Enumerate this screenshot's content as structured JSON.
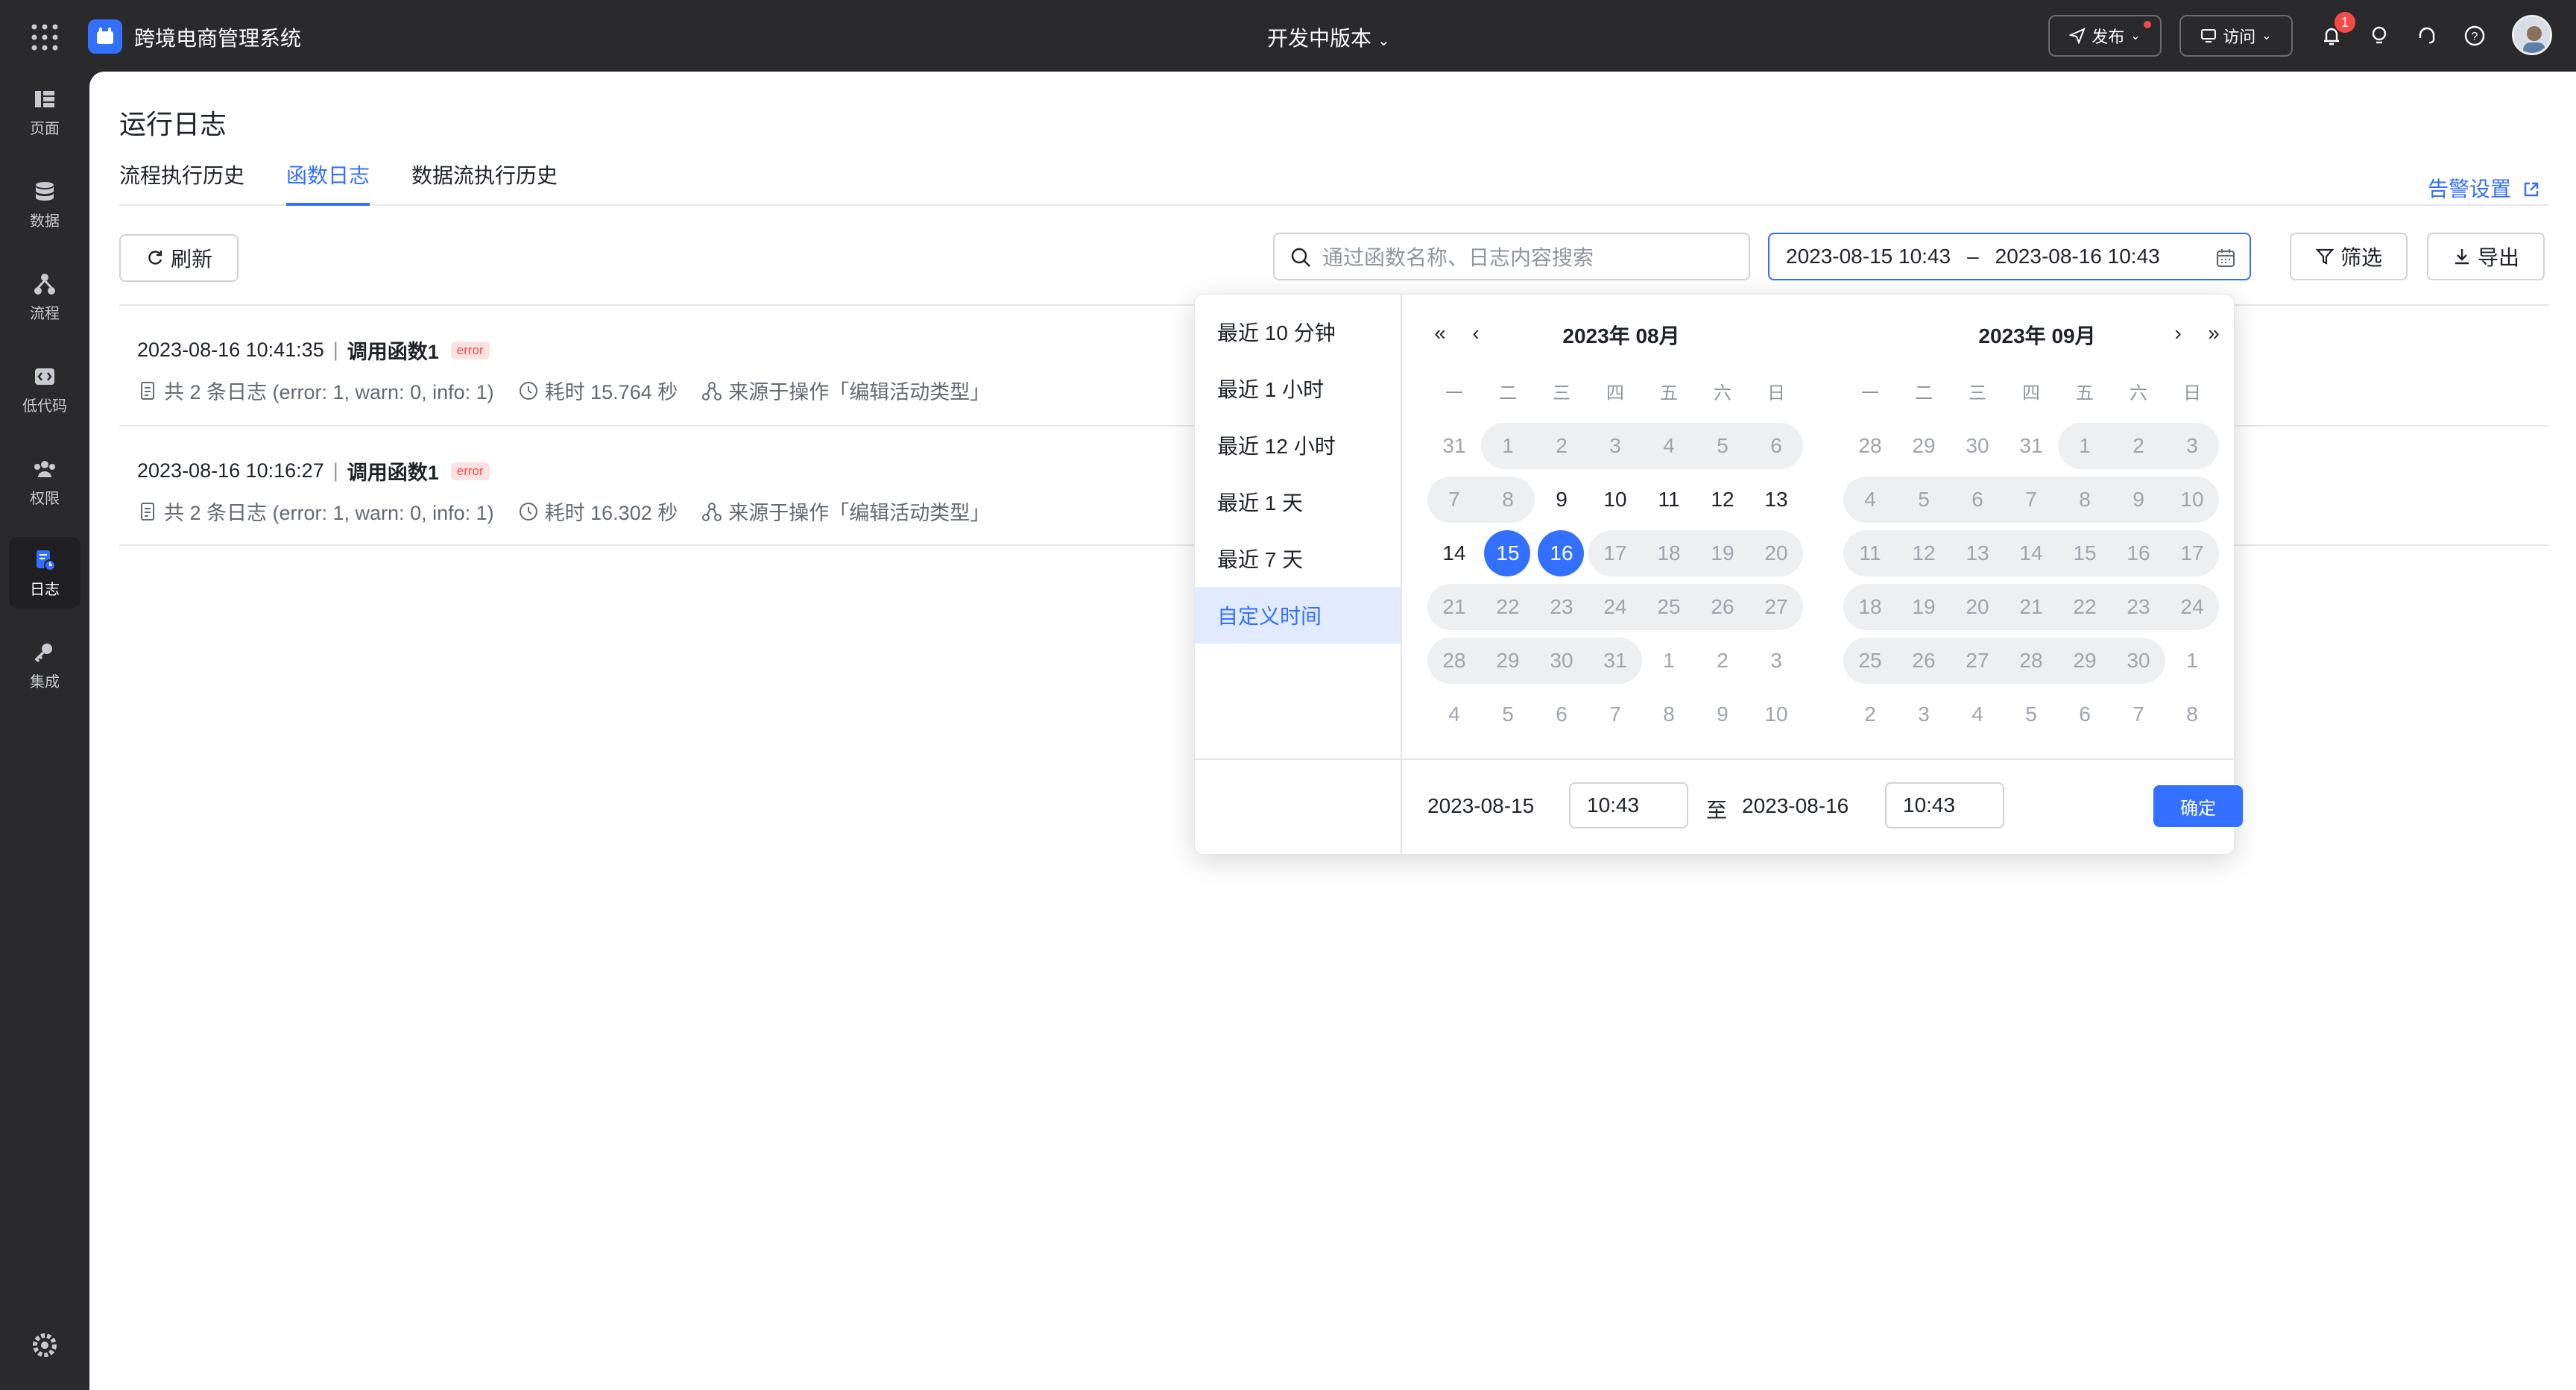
{
  "app": {
    "title": "跨境电商管理系统",
    "version_label": "开发中版本",
    "publish_label": "发布",
    "visit_label": "访问",
    "notification_count": "1",
    "accent_color": "#3370ff"
  },
  "rail": {
    "items": [
      {
        "label": "页面",
        "icon": "pages-icon"
      },
      {
        "label": "数据",
        "icon": "database-icon"
      },
      {
        "label": "流程",
        "icon": "flow-icon"
      },
      {
        "label": "低代码",
        "icon": "code-icon"
      },
      {
        "label": "权限",
        "icon": "users-icon"
      },
      {
        "label": "日志",
        "icon": "log-icon",
        "active": true
      },
      {
        "label": "集成",
        "icon": "key-icon"
      }
    ]
  },
  "page": {
    "title": "运行日志",
    "tabs": [
      {
        "label": "流程执行历史"
      },
      {
        "label": "函数日志",
        "active": true
      },
      {
        "label": "数据流执行历史"
      }
    ],
    "alarm_link": "告警设置"
  },
  "toolbar": {
    "refresh_label": "刷新",
    "search_placeholder": "通过函数名称、日志内容搜索",
    "date_start": "2023-08-15 10:43",
    "date_sep": "–",
    "date_end": "2023-08-16 10:43",
    "filter_label": "筛选",
    "export_label": "导出"
  },
  "logs": [
    {
      "time": "2023-08-16 10:41:35",
      "sep": "|",
      "function": "调用函数1",
      "level": "error",
      "summary": "共 2 条日志 (error: 1, warn: 0, info: 1)",
      "duration": "耗时 15.764 秒",
      "source": "来源于操作「编辑活动类型」"
    },
    {
      "time": "2023-08-16 10:16:27",
      "sep": "|",
      "function": "调用函数1",
      "level": "error",
      "summary": "共 2 条日志 (error: 1, warn: 0, info: 1)",
      "duration": "耗时 16.302 秒",
      "source": "来源于操作「编辑活动类型」"
    }
  ],
  "picker": {
    "presets": [
      "最近 10 分钟",
      "最近 1 小时",
      "最近 12 小时",
      "最近 1 天",
      "最近 7 天",
      "自定义时间"
    ],
    "active_preset": "自定义时间",
    "weekdays": [
      "一",
      "二",
      "三",
      "四",
      "五",
      "六",
      "日"
    ],
    "left": {
      "title": "2023年 08月",
      "days": [
        [
          "31",
          "1",
          "2",
          "3",
          "4",
          "5",
          "6"
        ],
        [
          "7",
          "8",
          "9",
          "10",
          "11",
          "12",
          "13"
        ],
        [
          "14",
          "15",
          "16",
          "17",
          "18",
          "19",
          "20"
        ],
        [
          "21",
          "22",
          "23",
          "24",
          "25",
          "26",
          "27"
        ],
        [
          "28",
          "29",
          "30",
          "31",
          "1",
          "2",
          "3"
        ],
        [
          "4",
          "5",
          "6",
          "7",
          "8",
          "9",
          "10"
        ]
      ]
    },
    "right": {
      "title": "2023年 09月",
      "days": [
        [
          "28",
          "29",
          "30",
          "31",
          "1",
          "2",
          "3"
        ],
        [
          "4",
          "5",
          "6",
          "7",
          "8",
          "9",
          "10"
        ],
        [
          "11",
          "12",
          "13",
          "14",
          "15",
          "16",
          "17"
        ],
        [
          "18",
          "19",
          "20",
          "21",
          "22",
          "23",
          "24"
        ],
        [
          "25",
          "26",
          "27",
          "28",
          "29",
          "30",
          "1"
        ],
        [
          "2",
          "3",
          "4",
          "5",
          "6",
          "7",
          "8"
        ]
      ]
    },
    "footer": {
      "start_date": "2023-08-15",
      "start_time": "10:43",
      "to": "至",
      "end_date": "2023-08-16",
      "end_time": "10:43",
      "confirm": "确定"
    }
  }
}
